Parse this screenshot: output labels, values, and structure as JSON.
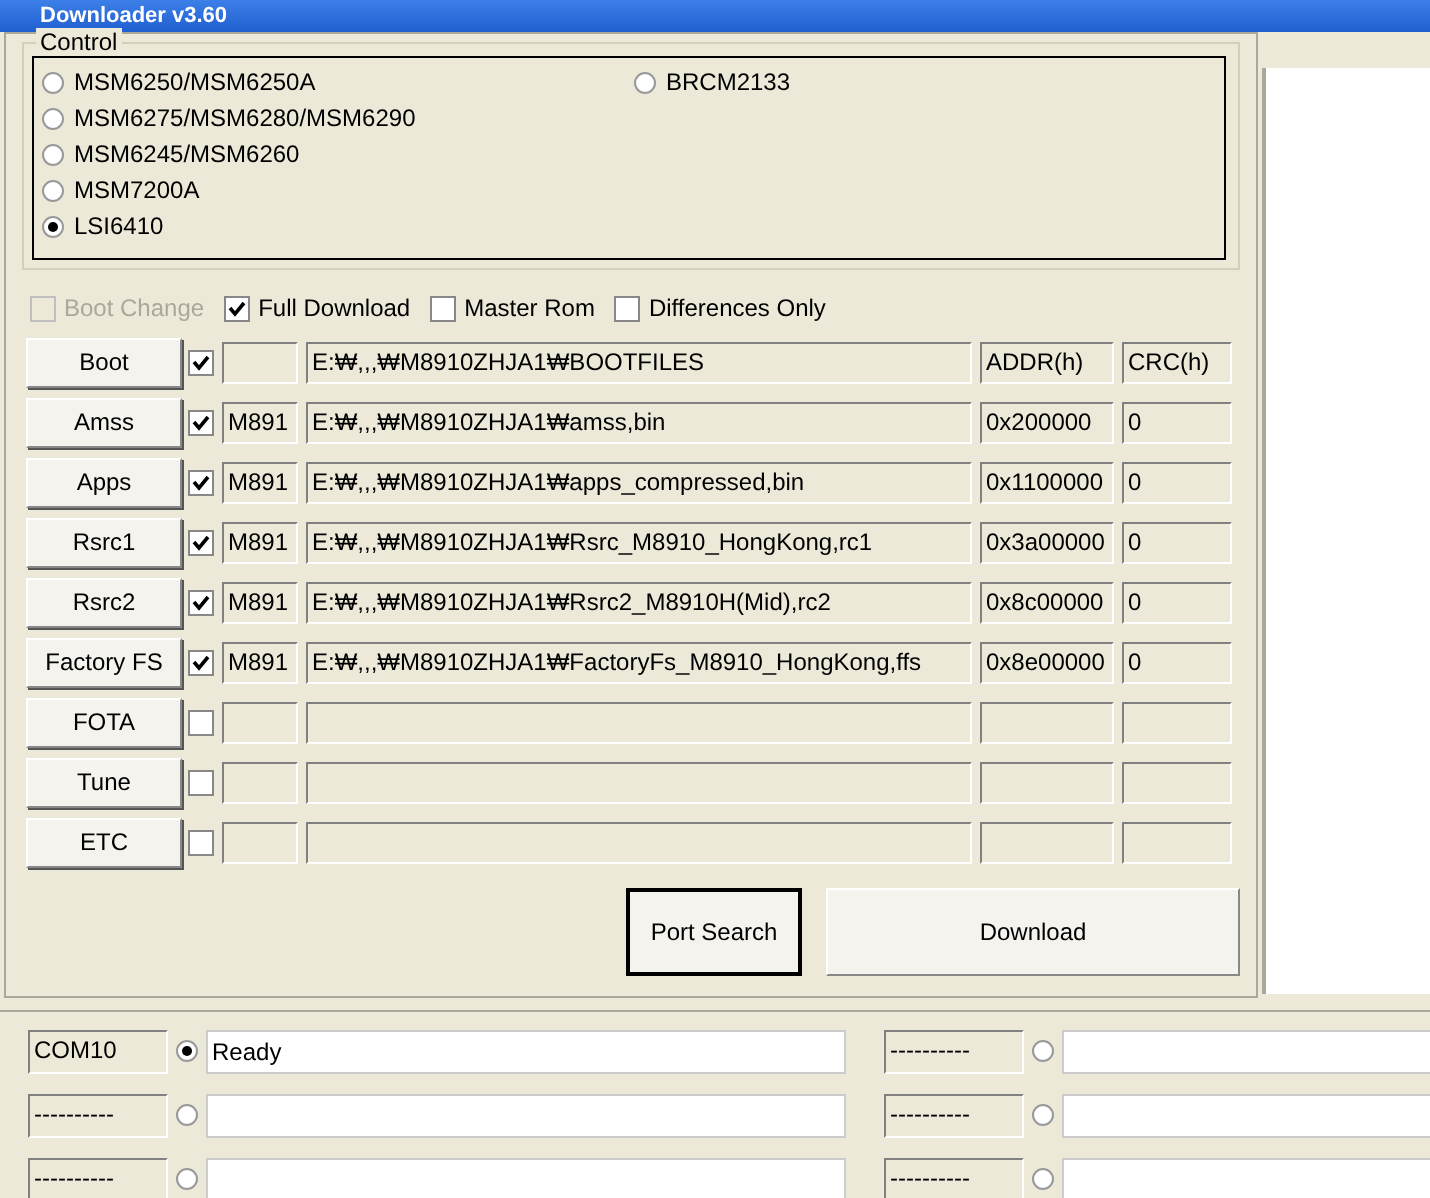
{
  "window": {
    "title": "Downloader v3.60"
  },
  "control": {
    "title": "Control",
    "chipsets": [
      {
        "label": "MSM6250/MSM6250A",
        "selected": false
      },
      {
        "label": "MSM6275/MSM6280/MSM6290",
        "selected": false
      },
      {
        "label": "MSM6245/MSM6260",
        "selected": false
      },
      {
        "label": "MSM7200A",
        "selected": false
      },
      {
        "label": "LSI6410",
        "selected": true
      },
      {
        "label": "BRCM2133",
        "selected": false
      }
    ]
  },
  "options": [
    {
      "label": "Boot Change",
      "checked": false,
      "disabled": true
    },
    {
      "label": "Full Download",
      "checked": true,
      "disabled": false
    },
    {
      "label": "Master Rom",
      "checked": false,
      "disabled": false
    },
    {
      "label": "Differences Only",
      "checked": false,
      "disabled": false
    }
  ],
  "files": [
    {
      "button": "Boot",
      "checked": true,
      "path": "E:₩,,,₩M8910ZHJA1₩BOOTFILES",
      "addr": "ADDR(h)",
      "crc": "CRC(h)"
    },
    {
      "button": "Amss",
      "checked": true,
      "code": "M891",
      "path": "E:₩,,,₩M8910ZHJA1₩amss,bin",
      "addr": "0x200000",
      "crc": "0"
    },
    {
      "button": "Apps",
      "checked": true,
      "code": "M891",
      "path": "E:₩,,,₩M8910ZHJA1₩apps_compressed,bin",
      "addr": "0x1100000",
      "crc": "0"
    },
    {
      "button": "Rsrc1",
      "checked": true,
      "code": "M891",
      "path": "E:₩,,,₩M8910ZHJA1₩Rsrc_M8910_HongKong,rc1",
      "addr": "0x3a00000",
      "crc": "0"
    },
    {
      "button": "Rsrc2",
      "checked": true,
      "code": "M891",
      "path": "E:₩,,,₩M8910ZHJA1₩Rsrc2_M8910H(Mid),rc2",
      "addr": "0x8c00000",
      "crc": "0"
    },
    {
      "button": "Factory FS",
      "checked": true,
      "code": "M891",
      "path": "E:₩,,,₩M8910ZHJA1₩FactoryFs_M8910_HongKong,ffs",
      "addr": "0x8e00000",
      "crc": "0"
    },
    {
      "button": "FOTA",
      "checked": false
    },
    {
      "button": "Tune",
      "checked": false
    },
    {
      "button": "ETC",
      "checked": false
    }
  ],
  "actions": [
    {
      "label": "Port Search",
      "default": true
    },
    {
      "label": "Download",
      "default": false
    }
  ],
  "ports": [
    {
      "port": "COM10",
      "selected": true,
      "status": "Ready"
    },
    {
      "port": "----------",
      "selected": false
    },
    {
      "port": "----------",
      "selected": false
    },
    {
      "port": "----------",
      "selected": false
    },
    {
      "port": "----------",
      "selected": false
    },
    {
      "port": "----------",
      "selected": false
    }
  ]
}
